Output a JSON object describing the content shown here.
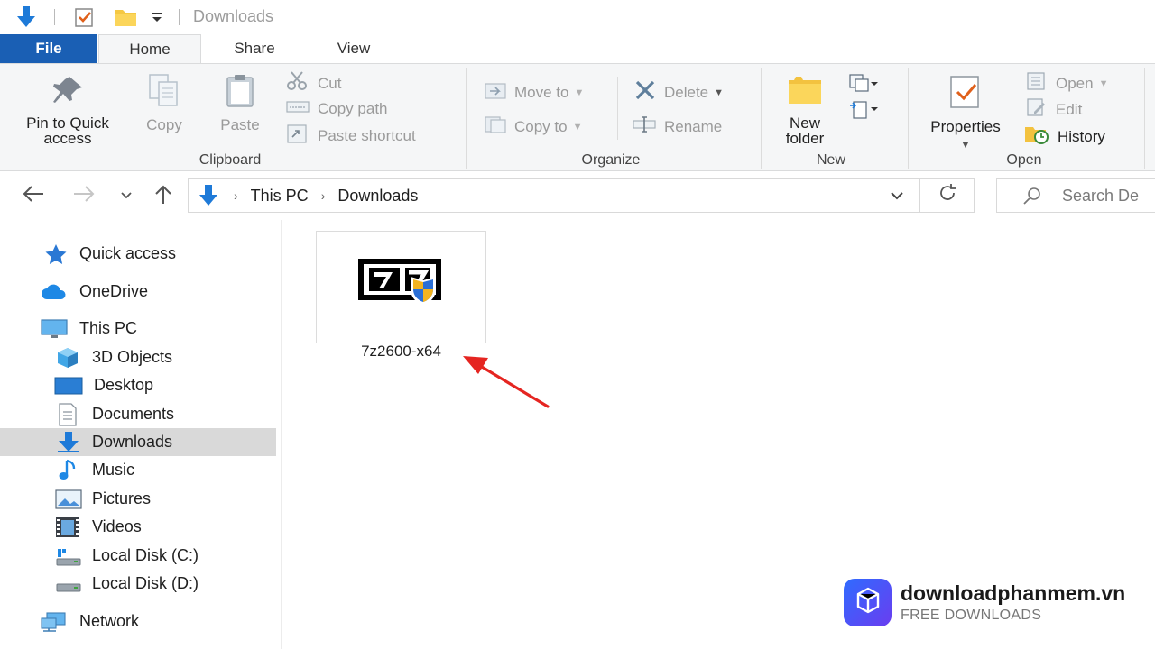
{
  "window": {
    "title": "Downloads"
  },
  "tabs": [
    {
      "label": "File"
    },
    {
      "label": "Home"
    },
    {
      "label": "Share"
    },
    {
      "label": "View"
    }
  ],
  "ribbon": {
    "clipboard": {
      "label": "Clipboard",
      "pin_line1": "Pin to Quick",
      "pin_line2": "access",
      "copy": "Copy",
      "paste": "Paste",
      "cut": "Cut",
      "copy_path": "Copy path",
      "paste_shortcut": "Paste shortcut"
    },
    "organize": {
      "label": "Organize",
      "move_to": "Move to",
      "copy_to": "Copy to",
      "delete": "Delete",
      "rename": "Rename"
    },
    "new": {
      "label": "New",
      "new_folder_line1": "New",
      "new_folder_line2": "folder"
    },
    "open": {
      "label": "Open",
      "properties": "Properties",
      "open": "Open",
      "edit": "Edit",
      "history": "History"
    }
  },
  "address": {
    "crumbs": [
      "This PC",
      "Downloads"
    ],
    "search_placeholder": "Search De"
  },
  "nav": {
    "items": [
      {
        "label": "Quick access",
        "icon": "star-icon"
      },
      {
        "label": "OneDrive",
        "icon": "cloud-icon"
      },
      {
        "label": "This PC",
        "icon": "monitor-icon"
      },
      {
        "label": "3D Objects",
        "icon": "cube-icon"
      },
      {
        "label": "Desktop",
        "icon": "desktop-icon"
      },
      {
        "label": "Documents",
        "icon": "document-icon"
      },
      {
        "label": "Downloads",
        "icon": "download-arrow-icon"
      },
      {
        "label": "Music",
        "icon": "music-note-icon"
      },
      {
        "label": "Pictures",
        "icon": "picture-icon"
      },
      {
        "label": "Videos",
        "icon": "film-icon"
      },
      {
        "label": "Local Disk (C:)",
        "icon": "drive-icon"
      },
      {
        "label": "Local Disk (D:)",
        "icon": "drive-icon"
      },
      {
        "label": "Network",
        "icon": "network-icon"
      }
    ],
    "selected": "Downloads"
  },
  "content": {
    "files": [
      {
        "name": "7z2600-x64",
        "icon": "7zip-installer-icon"
      }
    ]
  },
  "watermark": {
    "name": "downloadphanmem.vn",
    "tagline": "FREE DOWNLOADS"
  },
  "colors": {
    "file_tab": "#1a5fb4",
    "accent_blue": "#1e7ad8",
    "selection": "#d9d9d9",
    "annotation_arrow": "#e52521"
  }
}
